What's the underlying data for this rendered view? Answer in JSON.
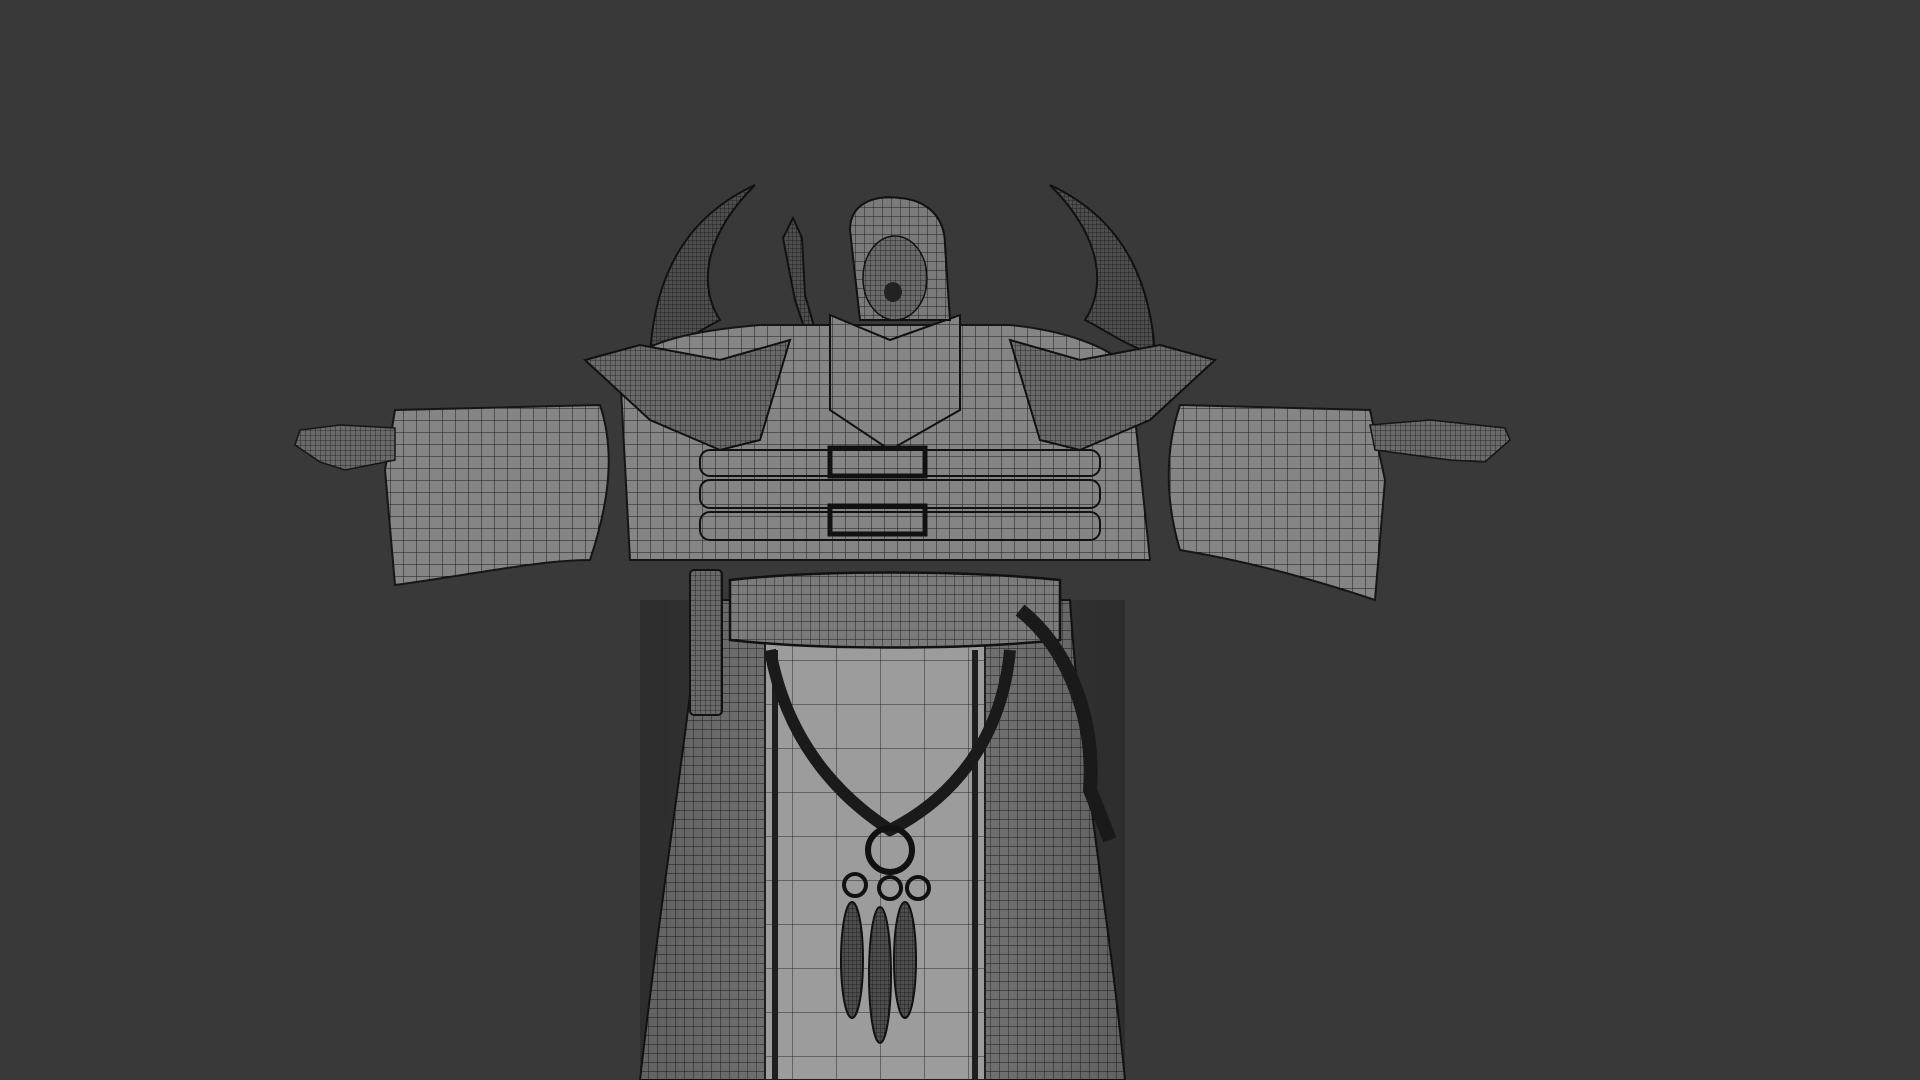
{
  "viewport": {
    "background_color": "#393939",
    "render_mode": "wireframe-on-shaded",
    "subject": "hooded-robed-character-t-pose"
  },
  "colors": {
    "surface_light": "#8c8c8c",
    "surface_mid": "#6e6e6e",
    "surface_dark": "#4a4a4a",
    "wire": "#1c1c1c",
    "panel_light": "#9a9a9a"
  }
}
